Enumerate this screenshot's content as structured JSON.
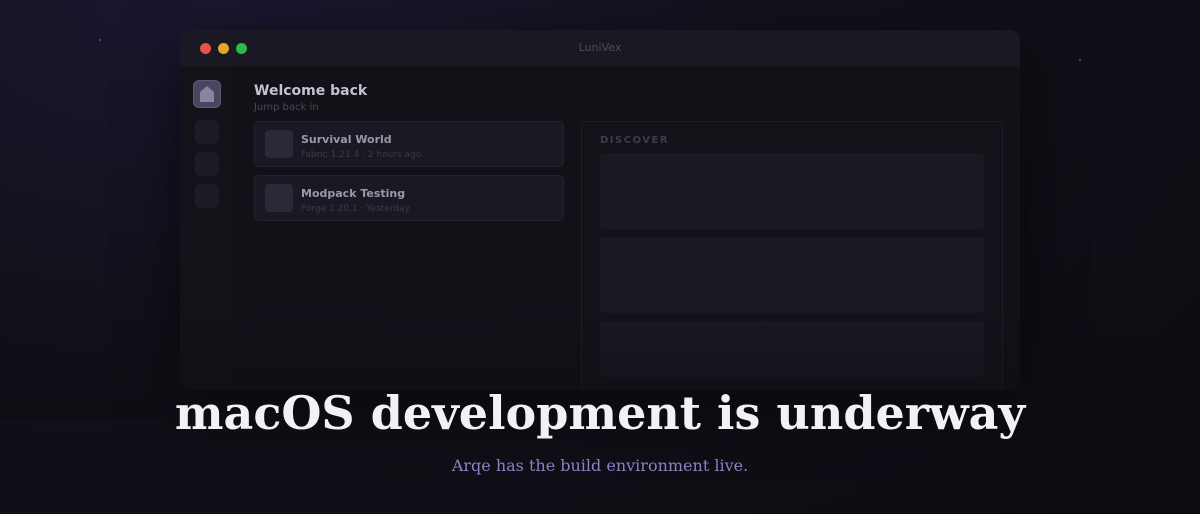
{
  "window": {
    "title": "LuniVex"
  },
  "sidebar": {
    "items": [
      {
        "icon": "home-icon",
        "active": true
      },
      {
        "icon": "blank-icon",
        "active": false
      },
      {
        "icon": "blank-icon",
        "active": false
      },
      {
        "icon": "blank-icon",
        "active": false
      }
    ]
  },
  "main": {
    "heading": "Welcome back",
    "subheading": "Jump back in",
    "recent": [
      {
        "name": "Survival World",
        "meta": "Fabric 1.21.4 · 2 hours ago"
      },
      {
        "name": "Modpack Testing",
        "meta": "Forge 1.20.1 · Yesterday"
      }
    ]
  },
  "discover": {
    "label": "DISCOVER"
  },
  "banner": {
    "headline": "macOS development is underway",
    "subline": "Arqe has the build environment live."
  },
  "colors": {
    "accent": "#8f7fc4",
    "traffic_red": "#e5534b",
    "traffic_yellow": "#e0a630",
    "traffic_green": "#2fb94a"
  }
}
